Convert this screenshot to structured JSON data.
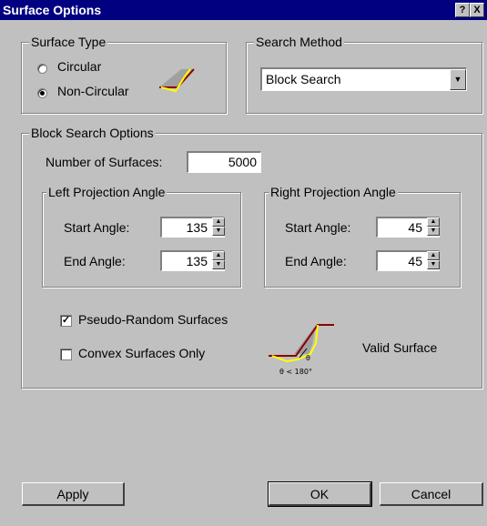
{
  "window": {
    "title": "Surface Options",
    "help_label": "?",
    "close_label": "X"
  },
  "surface_type": {
    "label": "Surface Type",
    "options": [
      {
        "label": "Circular",
        "selected": false
      },
      {
        "label": "Non-Circular",
        "selected": true
      }
    ]
  },
  "search_method": {
    "label": "Search Method",
    "value": "Block Search"
  },
  "block_search": {
    "label": "Block Search Options",
    "num_surfaces_label": "Number of Surfaces:",
    "num_surfaces_value": "5000",
    "left": {
      "label": "Left Projection Angle",
      "start_label": "Start Angle:",
      "start_value": "135",
      "end_label": "End Angle:",
      "end_value": "135"
    },
    "right": {
      "label": "Right Projection Angle",
      "start_label": "Start Angle:",
      "start_value": "45",
      "end_label": "End Angle:",
      "end_value": "45"
    },
    "pseudo_random": {
      "label": "Pseudo-Random Surfaces",
      "checked": true
    },
    "convex_only": {
      "label": "Convex Surfaces Only",
      "checked": false
    },
    "valid_surface_label": "Valid Surface",
    "angle_caption": "θ < 180°",
    "theta": "θ"
  },
  "buttons": {
    "apply": "Apply",
    "ok": "OK",
    "cancel": "Cancel"
  },
  "colors": {
    "title_bar": "#000080",
    "dialog_bg": "#c0c0c0",
    "slope_line": "#8b0000",
    "surface_line": "#ffff00",
    "fill": "#a0a0a0"
  }
}
